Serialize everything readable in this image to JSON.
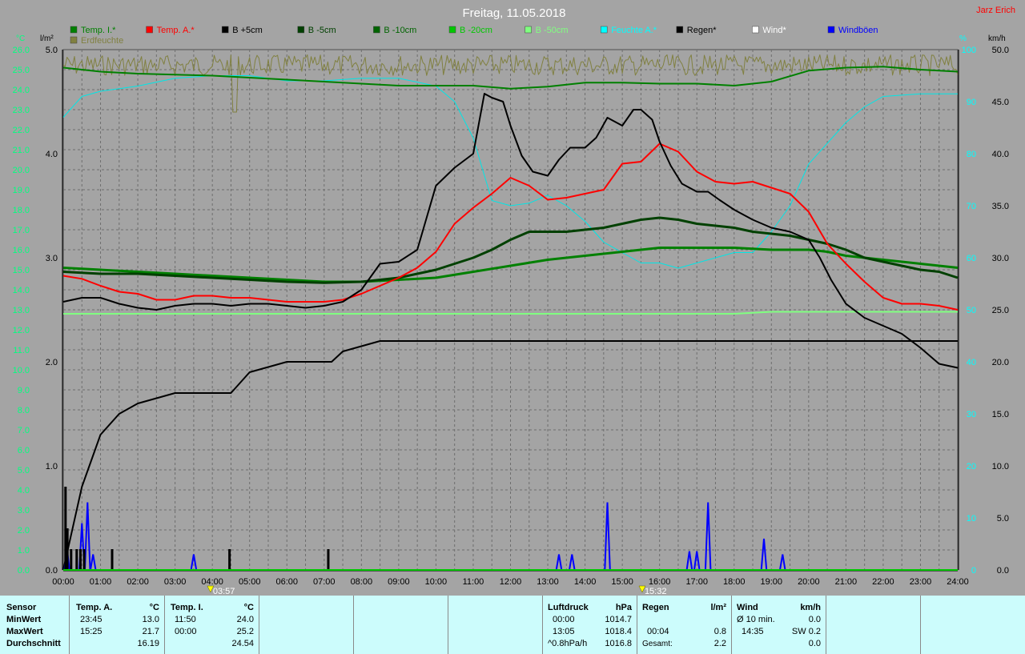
{
  "title": "Freitag, 11.05.2018",
  "station": "Jarz Erich",
  "axes": {
    "left_temp_unit": "°C",
    "left_rain_unit": "l/m²",
    "right_pct_unit": "%",
    "right_wind_unit": "km/h"
  },
  "legend": [
    {
      "label": "Temp. I.*",
      "color": "#008000"
    },
    {
      "label": "Temp. A.*",
      "color": "#ff0000"
    },
    {
      "label": "B +5cm",
      "color": "#000000"
    },
    {
      "label": "B -5cm",
      "color": "#004000"
    },
    {
      "label": "B -10cm",
      "color": "#006400"
    },
    {
      "label": "B -20cm",
      "color": "#00c800"
    },
    {
      "label": "B -50cm",
      "color": "#80ff80"
    },
    {
      "label": "Feuchte A.*",
      "color": "#00ffff"
    },
    {
      "label": "Regen*",
      "color": "#000000"
    },
    {
      "label": "Wind*",
      "color": "#ffffff"
    },
    {
      "label": "Windböen",
      "color": "#0000ff"
    },
    {
      "label": "Erdfeuchte",
      "color": "#808040"
    }
  ],
  "markers": [
    {
      "time": "03:57",
      "label": "03:57"
    },
    {
      "time": "15:32",
      "label": "15:32"
    }
  ],
  "chart_data": {
    "type": "line",
    "title": "Freitag, 11.05.2018",
    "x_unit": "time of day",
    "x_ticks": [
      "00:00",
      "01:00",
      "02:00",
      "03:00",
      "04:00",
      "05:00",
      "06:00",
      "07:00",
      "08:00",
      "09:00",
      "10:00",
      "11:00",
      "12:00",
      "13:00",
      "14:00",
      "15:00",
      "16:00",
      "17:00",
      "18:00",
      "19:00",
      "20:00",
      "21:00",
      "22:00",
      "23:00",
      "24:00"
    ],
    "xlim": [
      0,
      24
    ],
    "temp_axis": {
      "unit": "°C",
      "ylim": [
        0,
        26
      ],
      "ticks": [
        "0.0",
        "1.0",
        "2.0",
        "3.0",
        "4.0",
        "5.0",
        "6.0",
        "7.0",
        "8.0",
        "9.0",
        "10.0",
        "11.0",
        "12.0",
        "13.0",
        "14.0",
        "15.0",
        "16.0",
        "17.0",
        "18.0",
        "19.0",
        "20.0",
        "21.0",
        "22.0",
        "23.0",
        "24.0",
        "25.0",
        "26.0"
      ]
    },
    "rain_axis": {
      "unit": "l/m²",
      "ylim": [
        0,
        5
      ],
      "ticks": [
        "0.0",
        "1.0",
        "2.0",
        "3.0",
        "4.0",
        "5.0"
      ]
    },
    "pct_axis": {
      "unit": "%",
      "ylim": [
        0,
        100
      ],
      "ticks": [
        "0",
        "10",
        "20",
        "30",
        "40",
        "50",
        "60",
        "70",
        "80",
        "90",
        "100"
      ]
    },
    "wind_axis": {
      "unit": "km/h",
      "ylim": [
        0,
        50
      ],
      "ticks": [
        "0.0",
        "5.0",
        "10.0",
        "15.0",
        "20.0",
        "25.0",
        "30.0",
        "35.0",
        "40.0",
        "45.0",
        "50.0"
      ]
    },
    "grid": true,
    "series": [
      {
        "name": "Temp. I.*",
        "axis": "temp",
        "color": "#008000",
        "width": 2,
        "x": [
          0,
          1,
          2,
          3,
          4,
          5,
          6,
          7,
          8,
          9,
          10,
          11,
          12,
          13,
          14,
          15,
          16,
          17,
          18,
          19,
          20,
          21,
          22,
          23,
          24
        ],
        "y": [
          25.1,
          24.9,
          24.8,
          24.75,
          24.7,
          24.6,
          24.5,
          24.4,
          24.3,
          24.2,
          24.2,
          24.2,
          24.05,
          24.15,
          24.35,
          24.35,
          24.3,
          24.3,
          24.2,
          24.4,
          24.95,
          25.1,
          25.15,
          25.0,
          24.9
        ]
      },
      {
        "name": "Temp. A.*",
        "axis": "temp",
        "color": "#ff0000",
        "width": 2,
        "x": [
          0,
          0.5,
          1,
          1.5,
          2,
          2.5,
          3,
          3.5,
          4,
          4.5,
          5,
          5.5,
          6,
          6.5,
          7,
          7.5,
          8,
          8.5,
          9,
          9.5,
          10,
          10.5,
          11,
          11.5,
          12,
          12.5,
          13,
          13.5,
          14,
          14.5,
          15,
          15.5,
          16,
          16.5,
          17,
          17.5,
          18,
          18.5,
          19,
          19.5,
          20,
          20.5,
          21,
          21.5,
          22,
          22.5,
          23,
          23.5,
          24
        ],
        "y": [
          14.7,
          14.55,
          14.2,
          13.9,
          13.8,
          13.5,
          13.5,
          13.7,
          13.7,
          13.6,
          13.6,
          13.5,
          13.4,
          13.4,
          13.4,
          13.5,
          13.8,
          14.2,
          14.6,
          15.1,
          15.9,
          17.3,
          18.1,
          18.8,
          19.6,
          19.2,
          18.5,
          18.6,
          18.8,
          19.0,
          20.3,
          20.4,
          21.3,
          20.9,
          19.9,
          19.4,
          19.3,
          19.4,
          19.1,
          18.8,
          17.9,
          16.3,
          15.3,
          14.4,
          13.6,
          13.3,
          13.3,
          13.2,
          13.0
        ]
      },
      {
        "name": "B +5cm",
        "axis": "temp",
        "color": "#000000",
        "width": 2,
        "x": [
          0,
          0.5,
          1,
          1.5,
          2,
          2.5,
          3,
          3.5,
          4,
          4.5,
          5,
          5.5,
          6,
          6.5,
          7,
          7.5,
          8,
          8.5,
          9,
          9.5,
          10,
          10.5,
          11,
          11.3,
          11.5,
          11.8,
          12,
          12.3,
          12.6,
          13,
          13.3,
          13.6,
          14,
          14.3,
          14.6,
          15,
          15.3,
          15.5,
          15.8,
          16,
          16.3,
          16.6,
          17,
          17.3,
          17.6,
          18,
          18.5,
          19,
          19.5,
          20,
          20.3,
          20.6,
          21,
          21.5,
          22,
          22.5,
          23,
          23.5,
          24
        ],
        "y": [
          13.4,
          13.6,
          13.6,
          13.3,
          13.1,
          13.0,
          13.2,
          13.3,
          13.3,
          13.2,
          13.3,
          13.3,
          13.2,
          13.1,
          13.2,
          13.4,
          14.0,
          15.3,
          15.4,
          16.0,
          19.2,
          20.1,
          20.8,
          23.8,
          23.6,
          23.4,
          22.2,
          20.7,
          19.9,
          19.7,
          20.5,
          21.1,
          21.1,
          21.6,
          22.6,
          22.2,
          23.0,
          23.0,
          22.5,
          21.4,
          20.2,
          19.3,
          18.9,
          18.9,
          18.5,
          18.0,
          17.5,
          17.1,
          16.9,
          16.5,
          15.6,
          14.5,
          13.3,
          12.6,
          12.2,
          11.8,
          11.1,
          10.3,
          10.1
        ]
      },
      {
        "name": "B -5cm",
        "axis": "temp",
        "color": "#004000",
        "width": 3,
        "x": [
          0,
          1,
          2,
          3,
          4,
          5,
          6,
          7,
          8,
          9,
          10,
          11,
          11.5,
          12,
          12.5,
          13,
          13.5,
          14,
          14.5,
          15,
          15.5,
          16,
          16.5,
          17,
          17.5,
          18,
          18.5,
          19,
          19.5,
          20,
          20.5,
          21,
          21.5,
          22,
          22.5,
          23,
          23.5,
          24
        ],
        "y": [
          14.9,
          14.8,
          14.8,
          14.7,
          14.6,
          14.5,
          14.4,
          14.35,
          14.4,
          14.6,
          15.0,
          15.6,
          16.0,
          16.5,
          16.9,
          16.9,
          16.9,
          17.0,
          17.1,
          17.3,
          17.5,
          17.6,
          17.5,
          17.3,
          17.2,
          17.1,
          16.9,
          16.8,
          16.7,
          16.5,
          16.3,
          16.0,
          15.6,
          15.4,
          15.2,
          15.0,
          14.9,
          14.6
        ]
      },
      {
        "name": "B -10cm",
        "axis": "temp",
        "color": "#008000",
        "width": 3,
        "x": [
          0,
          1,
          2,
          3,
          4,
          5,
          6,
          7,
          8,
          9,
          10,
          11,
          12,
          13,
          14,
          15,
          16,
          17,
          18,
          19,
          20,
          20.5,
          21,
          22,
          23,
          24
        ],
        "y": [
          15.1,
          15.0,
          14.9,
          14.8,
          14.7,
          14.6,
          14.5,
          14.4,
          14.4,
          14.5,
          14.6,
          14.9,
          15.2,
          15.5,
          15.7,
          15.9,
          16.1,
          16.1,
          16.1,
          16.0,
          16.0,
          15.9,
          15.7,
          15.5,
          15.3,
          15.1
        ]
      },
      {
        "name": "B -50cm",
        "axis": "temp",
        "color": "#80ff80",
        "width": 2,
        "x": [
          0,
          6,
          12,
          18,
          19,
          24
        ],
        "y": [
          12.8,
          12.8,
          12.8,
          12.8,
          12.9,
          12.9
        ]
      },
      {
        "name": "Feuchte A.*",
        "axis": "pct",
        "color": "#00e6e6",
        "width": 1,
        "x": [
          0,
          0.5,
          1,
          1.5,
          2,
          3,
          4,
          5,
          6,
          7,
          8,
          9,
          10,
          10.5,
          11,
          11.5,
          12,
          12.5,
          13,
          13.5,
          14,
          14.5,
          15,
          15.5,
          16,
          16.5,
          17,
          17.5,
          18,
          18.5,
          19,
          19.5,
          20,
          21,
          21.5,
          22,
          23,
          24
        ],
        "y": [
          87,
          91,
          92,
          92.5,
          93,
          94.5,
          95,
          95,
          94,
          94,
          94.5,
          94.5,
          93,
          90,
          83,
          71,
          70,
          70.5,
          72,
          70,
          67,
          63,
          61,
          59,
          59,
          58,
          59,
          60,
          61,
          61,
          65,
          70,
          78,
          86,
          89,
          91,
          91.5,
          91.5
        ]
      },
      {
        "name": "Erdfeuchte",
        "axis": "pct",
        "color": "#808040",
        "width": 1,
        "jagged": true,
        "x": [
          0,
          24
        ],
        "y": [
          99,
          99
        ]
      },
      {
        "name": "Regen*",
        "axis": "rain",
        "color": "#000000",
        "width": 2,
        "x": [
          0,
          0.5,
          1,
          1.5,
          2,
          3,
          4,
          4.5,
          5,
          6,
          7,
          7.2,
          7.5,
          8,
          8.5,
          9,
          12,
          24
        ],
        "y": [
          0,
          0.8,
          1.3,
          1.5,
          1.6,
          1.7,
          1.7,
          1.7,
          1.9,
          2.0,
          2.0,
          2.0,
          2.1,
          2.15,
          2.2,
          2.2,
          2.2,
          2.2
        ]
      }
    ],
    "bars": [
      {
        "name": "Regen*",
        "axis": "rain",
        "color": "#000000",
        "x": [
          0.05,
          0.1,
          0.2,
          0.35,
          0.45,
          0.55,
          1.3,
          4.45,
          7.1
        ],
        "y": [
          0.8,
          0.4,
          0.2,
          0.2,
          0.2,
          0.2,
          0.2,
          0.2,
          0.2
        ]
      }
    ],
    "gusts": {
      "name": "Windböen",
      "axis": "wind",
      "color": "#0000ff",
      "peaks": [
        {
          "x": 0.1,
          "y": 2.0
        },
        {
          "x": 0.5,
          "y": 4.5
        },
        {
          "x": 0.65,
          "y": 6.5
        },
        {
          "x": 0.8,
          "y": 1.5
        },
        {
          "x": 3.5,
          "y": 1.5
        },
        {
          "x": 13.3,
          "y": 1.5
        },
        {
          "x": 13.65,
          "y": 1.5
        },
        {
          "x": 14.6,
          "y": 6.5
        },
        {
          "x": 16.8,
          "y": 1.8
        },
        {
          "x": 17.0,
          "y": 1.8
        },
        {
          "x": 17.3,
          "y": 6.5
        },
        {
          "x": 18.8,
          "y": 3.0
        },
        {
          "x": 19.3,
          "y": 1.5
        }
      ]
    }
  },
  "summary": {
    "sensor_label": "Sensor",
    "rows": [
      "MinWert",
      "MaxWert",
      "Durchschnitt"
    ],
    "temp_a": {
      "title": "Temp. A.",
      "unit": "°C",
      "min_time": "23:45",
      "min": "13.0",
      "max_time": "15:25",
      "max": "21.7",
      "avg": "16.19"
    },
    "temp_i": {
      "title": "Temp. I.",
      "unit": "°C",
      "min_time": "11:50",
      "min": "24.0",
      "max_time": "00:00",
      "max": "25.2",
      "avg": "24.54"
    },
    "pressure": {
      "title": "Luftdruck",
      "unit": "hPa",
      "min_time": "00:00",
      "min": "1014.7",
      "max_time": "13:05",
      "max": "1018.4",
      "trend": "^0.8hPa/h",
      "avg": "1016.8"
    },
    "rain": {
      "title": "Regen",
      "unit": "l/m²",
      "max_time": "00:04",
      "max": "0.8",
      "total_label": "Gesamt:",
      "total": "2.2"
    },
    "wind": {
      "title": "Wind",
      "unit": "km/h",
      "avg_label": "Ø 10 min.",
      "avg": "0.0",
      "max_time": "14:35",
      "max_dir": "SW 0.2",
      "last": "0.0"
    }
  }
}
